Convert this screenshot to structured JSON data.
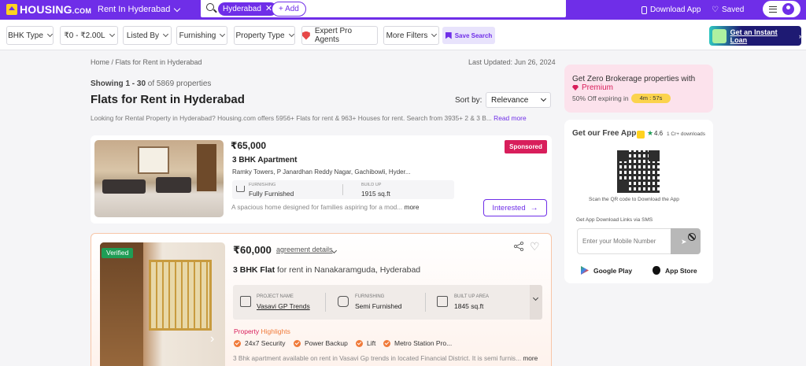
{
  "header": {
    "logo_text": "HOUSING",
    "logo_suffix": ".COM",
    "city_select": "Rent In Hyderabad",
    "search_chip": "Hyderabad",
    "add_label": "+ Add",
    "download_app": "Download App",
    "saved": "Saved"
  },
  "filters": {
    "bhk": "BHK Type",
    "price": "₹0 - ₹2.00L",
    "listed_by": "Listed By",
    "furnishing": "Furnishing",
    "property_type": "Property Type",
    "expert_agents": "Expert Pro Agents",
    "more_filters": "More Filters",
    "save_search": "Save Search",
    "instant_loan": "Get an Instant Loan"
  },
  "main": {
    "breadcrumb": "Home / Flats for Rent in Hyderabad",
    "last_updated": "Last Updated: Jun 26, 2024",
    "showing_prefix": "Showing 1 - 30",
    "showing_suffix": "of 5869 properties",
    "title": "Flats for Rent in Hyderabad",
    "sort_label": "Sort by:",
    "sort_value": "Relevance",
    "intro": "Looking for Rental Property in Hyderabad? Housing.com offers 5956+ Flats for rent & 963+ Houses for rent. Search from 3935+ 2 & 3 B...",
    "read_more": "Read more"
  },
  "listings": [
    {
      "price": "₹65,000",
      "badge": "Sponsored",
      "type": "3 BHK Apartment",
      "address": "Ramky Towers, P Janardhan Reddy Nagar, Gachibowli, Hyder...",
      "furnishing_label": "FURNISHING",
      "furnishing_value": "Fully Furnished",
      "buildup_label": "BUILD UP",
      "buildup_value": "1915 sq.ft",
      "description": "A spacious home designed for families aspiring for a mod...",
      "more": "more",
      "cta": "Interested"
    },
    {
      "verified": "Verified",
      "price": "₹60,000",
      "agreement": "agreement details",
      "type_bold": "3 BHK Flat",
      "type_rest": "for rent in Nanakaramguda, Hyderabad",
      "project_label": "PROJECT NAME",
      "project_value": "Vasavi GP Trends",
      "furnishing_label": "FURNISHING",
      "furnishing_value": "Semi Furnished",
      "builtup_label": "BUILT UP AREA",
      "builtup_value": "1845 sq.ft",
      "highlights_title_a": "Property",
      "highlights_title_b": "Highlights",
      "highlights": [
        "24x7 Security",
        "Power Backup",
        "Lift",
        "Metro Station Pro..."
      ],
      "description": "3 Bhk apartment available on rent in Vasavi Gp trends in located Financial District. It is semi furnis...",
      "more": "more"
    }
  ],
  "sidebar": {
    "premium_line1": "Get Zero Brokerage properties with",
    "premium_line2": "Premium",
    "premium_line3": "50% Off expiring in",
    "timer": "4m : 57s",
    "app_title": "Get our Free App",
    "rating": "4.6",
    "downloads": "1 Cr+ downloads",
    "qr_caption": "Scan the QR code to Download the App",
    "sms_label": "Get App Download Links via SMS",
    "mobile_placeholder": "Enter your Mobile Number",
    "google_play": "Google Play",
    "app_store": "App Store"
  },
  "colors": {
    "brand": "#6f2ee8",
    "sponsored": "#d81e5b",
    "verified": "#1f9d55",
    "highlight": "#f07a3a"
  }
}
